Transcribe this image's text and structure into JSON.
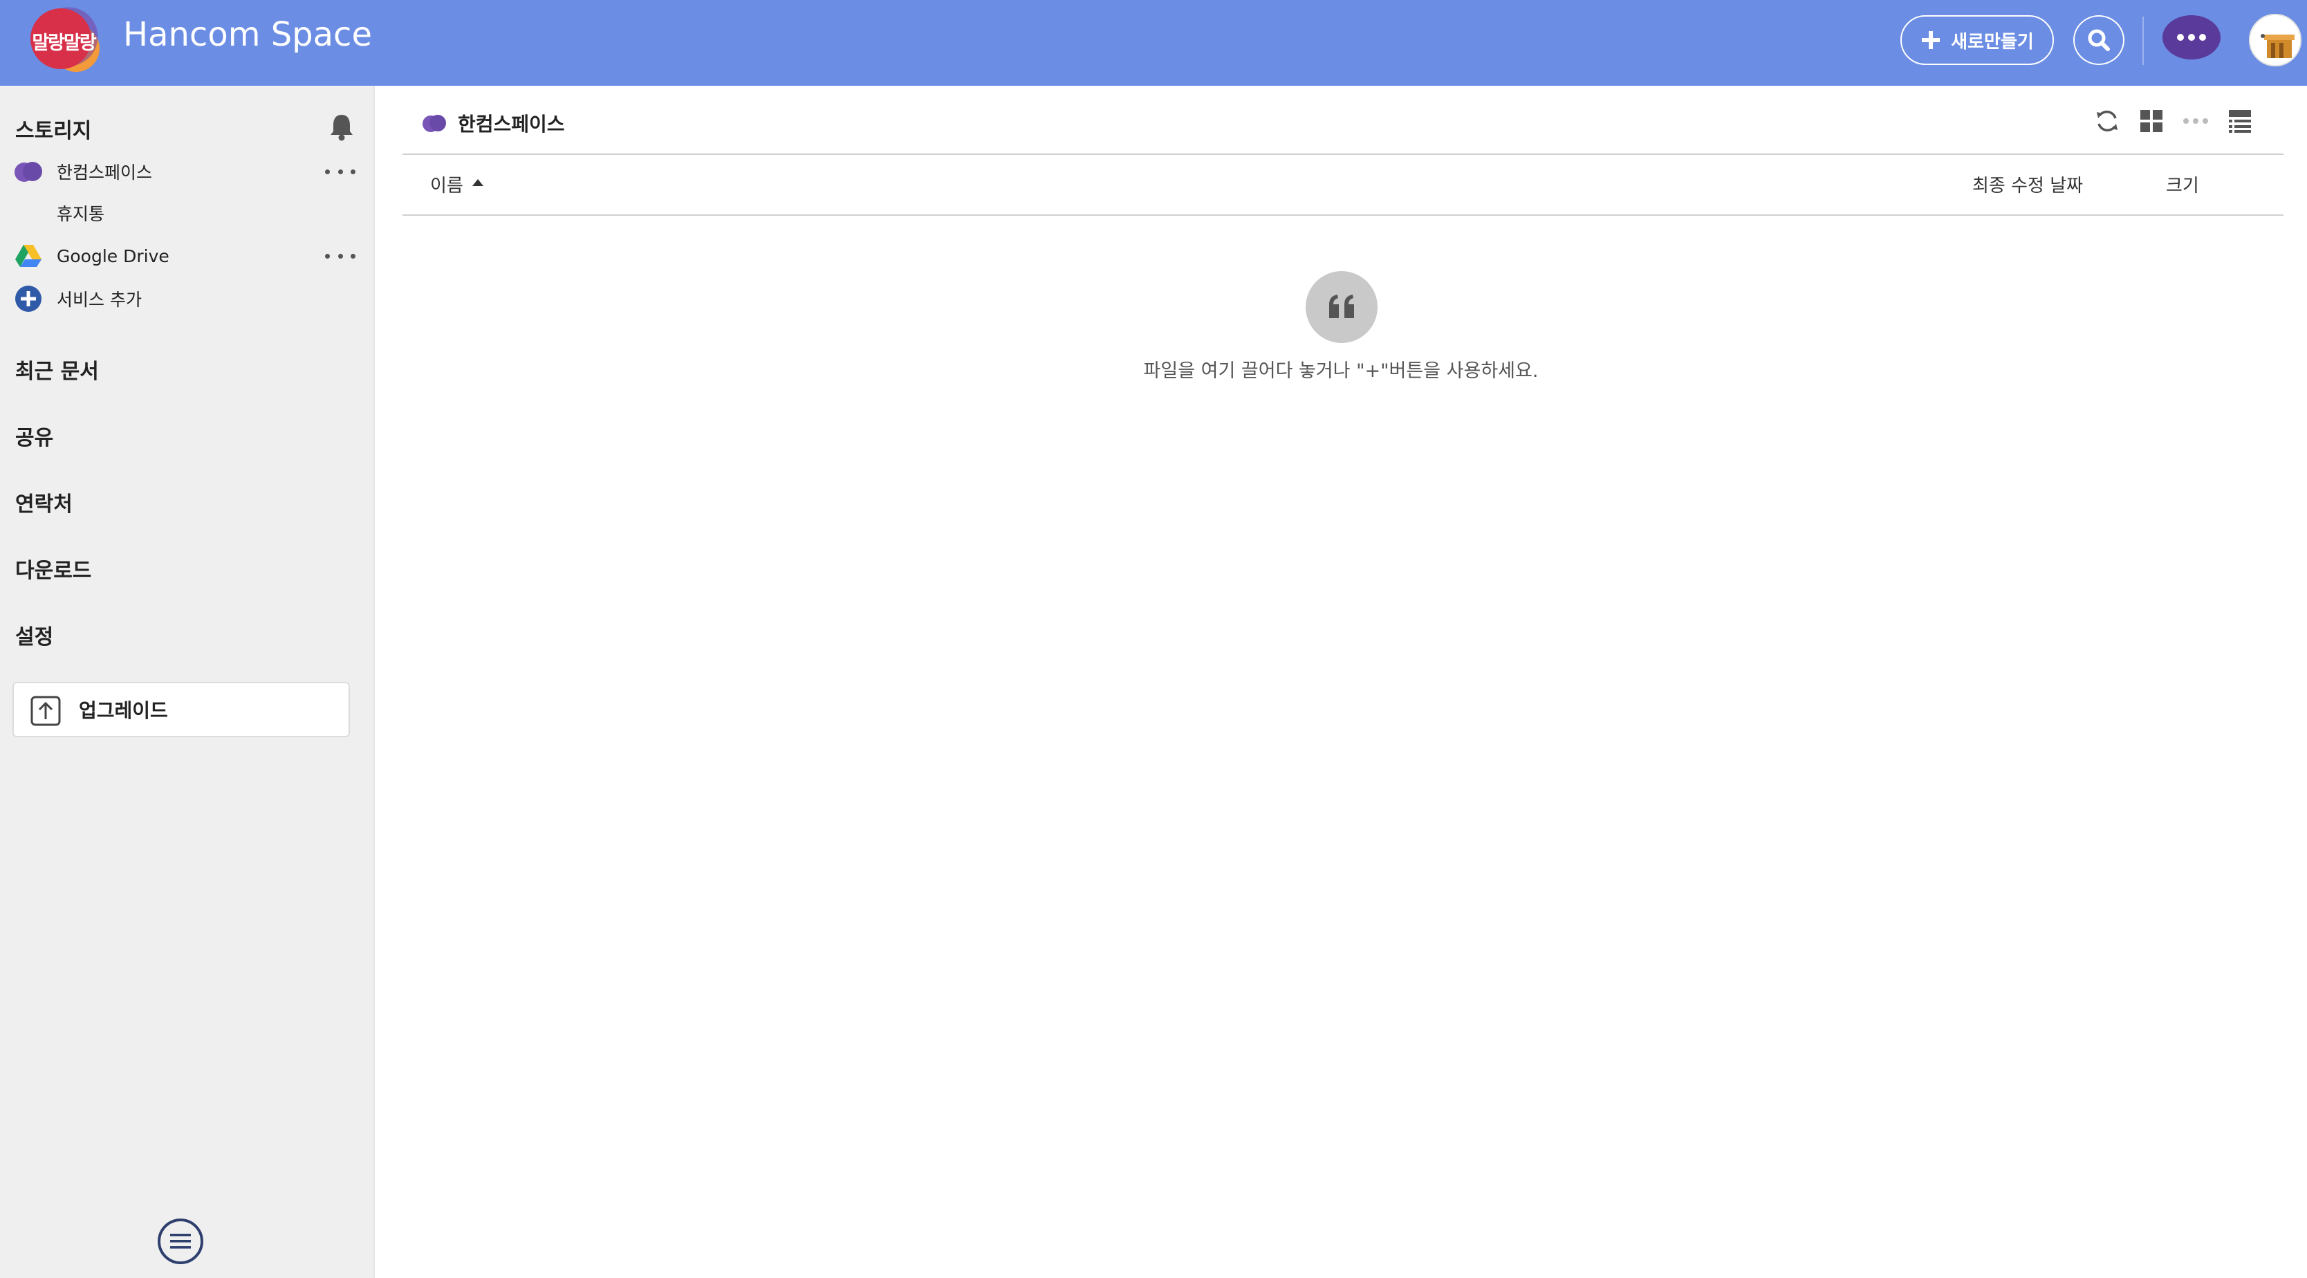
{
  "header": {
    "logo_text": "말랑말랑",
    "app_title": "Hancom Space",
    "new_button_label": "새로만들기"
  },
  "sidebar": {
    "storage_heading": "스토리지",
    "items": [
      {
        "label": "한컴스페이스",
        "icon": "hancom-cloud-icon"
      },
      {
        "label": "휴지통",
        "icon": ""
      },
      {
        "label": "Google Drive",
        "icon": "google-drive-icon"
      },
      {
        "label": "서비스 추가",
        "icon": "plus-circle-icon"
      }
    ],
    "sections": [
      {
        "label": "최근 문서"
      },
      {
        "label": "공유"
      },
      {
        "label": "연락처"
      },
      {
        "label": "다운로드"
      },
      {
        "label": "설정"
      }
    ],
    "upgrade_label": "업그레이드"
  },
  "main": {
    "breadcrumb": "한컴스페이스",
    "columns": {
      "name": "이름",
      "modified": "최종 수정 날짜",
      "size": "크기"
    },
    "empty_message": "파일을 여기 끌어다 놓거나 \"+\"버튼을 사용하세요."
  },
  "colors": {
    "header_bg": "#6b8de3",
    "brand_purple": "#6a4aa8",
    "sidebar_bg": "#efefef",
    "accent_blue": "#2f5aa8"
  }
}
